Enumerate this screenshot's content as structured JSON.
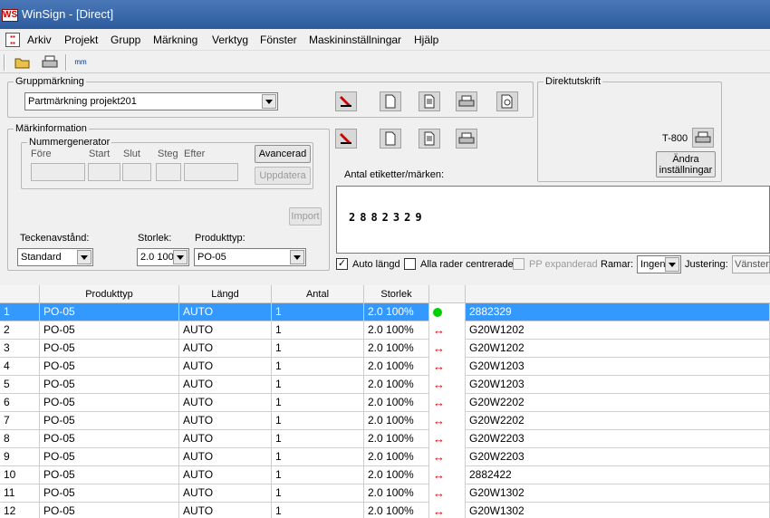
{
  "window": {
    "title": "WinSign - [Direct]",
    "app_icon": "winsign-icon"
  },
  "menu": {
    "items": [
      "Arkiv",
      "Projekt",
      "Grupp",
      "Märkning",
      "Verktyg",
      "Fönster",
      "Maskininställningar",
      "Hjälp"
    ]
  },
  "toolbar": {
    "icons": [
      "open-folder-icon",
      "print-icon",
      "mm-scale-icon"
    ],
    "mm_label": "mm"
  },
  "group_marking": {
    "legend": "Gruppmärkning",
    "selected": "Partmärkning projekt201",
    "buttons": [
      "marker-pen-icon",
      "new-page-icon",
      "edit-page-icon",
      "printer-icon",
      "print-preview-icon"
    ]
  },
  "mark_info": {
    "legend": "Märkinformation",
    "buttons": [
      "marker-pen-icon",
      "new-page-icon",
      "edit-page-icon",
      "printer-icon"
    ],
    "number_generator": {
      "legend": "Nummergenerator",
      "labels": {
        "before": "Före",
        "start": "Start",
        "end": "Slut",
        "step": "Steg",
        "after": "Efter"
      },
      "advanced_label": "Avancerad",
      "update_label": "Uppdatera"
    },
    "import_label": "Import",
    "spacing_label": "Teckenavstånd:",
    "spacing_value": "Standard",
    "size_label": "Storlek:",
    "size_value": "2.0 100",
    "product_type_label": "Produkttyp:",
    "product_type_value": "PO-05"
  },
  "direct_print": {
    "legend": "Direktutskrift",
    "printer": "T-800",
    "change_settings_line1": "Ändra",
    "change_settings_line2": "inställningar"
  },
  "labels_count_label": "Antal etiketter/märken:",
  "preview_text": "2882329",
  "options": {
    "auto_length": {
      "label": "Auto längd",
      "checked": true
    },
    "center_all": {
      "label": "Alla rader centrerade",
      "checked": false
    },
    "pp_expanded": {
      "label": "PP expanderad",
      "checked": false,
      "disabled": true
    },
    "frame_label": "Ramar:",
    "frame_value": "Ingen",
    "justify_label": "Justering:",
    "justify_value": "Vänster"
  },
  "table": {
    "columns": [
      "",
      "Produkttyp",
      "Längd",
      "Antal",
      "Storlek",
      "",
      ""
    ],
    "rows": [
      {
        "n": "1",
        "type": "PO-05",
        "length": "AUTO",
        "qty": "1",
        "size": "2.0 100%",
        "status": "ok",
        "text": "2882329",
        "selected": true
      },
      {
        "n": "2",
        "type": "PO-05",
        "length": "AUTO",
        "qty": "1",
        "size": "2.0 100%",
        "status": "arrow",
        "text": "G20W1202"
      },
      {
        "n": "3",
        "type": "PO-05",
        "length": "AUTO",
        "qty": "1",
        "size": "2.0 100%",
        "status": "arrow",
        "text": "G20W1202"
      },
      {
        "n": "4",
        "type": "PO-05",
        "length": "AUTO",
        "qty": "1",
        "size": "2.0 100%",
        "status": "arrow",
        "text": "G20W1203"
      },
      {
        "n": "5",
        "type": "PO-05",
        "length": "AUTO",
        "qty": "1",
        "size": "2.0 100%",
        "status": "arrow",
        "text": "G20W1203"
      },
      {
        "n": "6",
        "type": "PO-05",
        "length": "AUTO",
        "qty": "1",
        "size": "2.0 100%",
        "status": "arrow",
        "text": "G20W2202"
      },
      {
        "n": "7",
        "type": "PO-05",
        "length": "AUTO",
        "qty": "1",
        "size": "2.0 100%",
        "status": "arrow",
        "text": "G20W2202"
      },
      {
        "n": "8",
        "type": "PO-05",
        "length": "AUTO",
        "qty": "1",
        "size": "2.0 100%",
        "status": "arrow",
        "text": "G20W2203"
      },
      {
        "n": "9",
        "type": "PO-05",
        "length": "AUTO",
        "qty": "1",
        "size": "2.0 100%",
        "status": "arrow",
        "text": "G20W2203"
      },
      {
        "n": "10",
        "type": "PO-05",
        "length": "AUTO",
        "qty": "1",
        "size": "2.0 100%",
        "status": "arrow",
        "text": "2882422"
      },
      {
        "n": "11",
        "type": "PO-05",
        "length": "AUTO",
        "qty": "1",
        "size": "2.0 100%",
        "status": "arrow",
        "text": "G20W1302"
      },
      {
        "n": "12",
        "type": "PO-05",
        "length": "AUTO",
        "qty": "1",
        "size": "2.0 100%",
        "status": "arrow",
        "text": "G20W1302"
      }
    ]
  },
  "colors": {
    "selection": "#3399ff",
    "status_ok": "#00d000",
    "status_arrow": "#e00000"
  }
}
